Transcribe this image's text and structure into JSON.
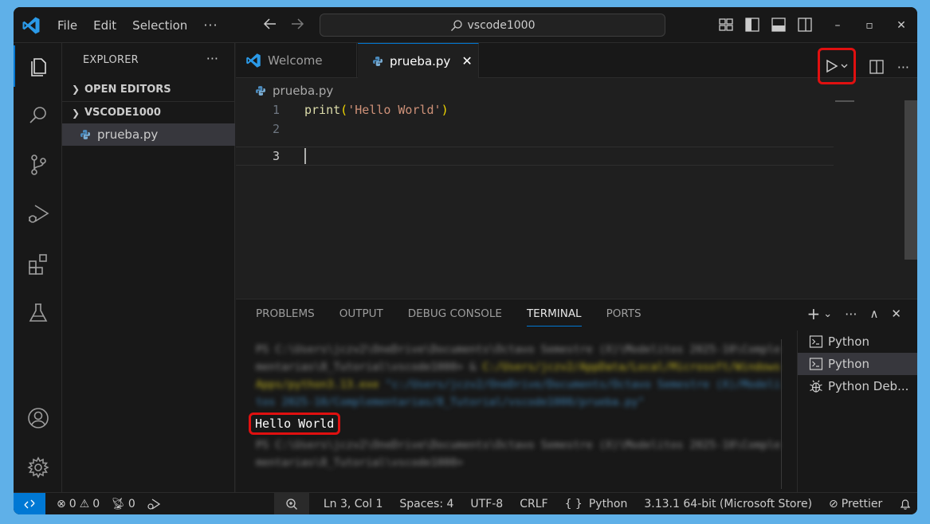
{
  "menu": {
    "file": "File",
    "edit": "Edit",
    "selection": "Selection",
    "more": "···"
  },
  "search": {
    "text": "vscode1000"
  },
  "window_controls": {
    "minimize": "–",
    "restore": "▫",
    "close": "✕"
  },
  "explorer": {
    "title": "EXPLORER",
    "more": "···",
    "open_editors": "OPEN EDITORS",
    "folder": "VSCODE1000",
    "file": "prueba.py"
  },
  "tabs": [
    {
      "label": "Welcome"
    },
    {
      "label": "prueba.py",
      "close": "✕"
    }
  ],
  "editor": {
    "breadcrumb": "prueba.py",
    "lines": [
      {
        "n": "1",
        "fn": "print",
        "open": "(",
        "str": "'Hello World'",
        "close": ")"
      },
      {
        "n": "2"
      },
      {
        "n": "3"
      }
    ]
  },
  "panel": {
    "tabs": [
      "PROBLEMS",
      "OUTPUT",
      "DEBUG CONSOLE",
      "TERMINAL",
      "PORTS"
    ],
    "active_tab": "TERMINAL",
    "actions": {
      "add": "+",
      "dropdown": "⌄",
      "more": "···",
      "maximize": "∧",
      "close": "✕"
    },
    "terminal": {
      "cmd1": "PS C:\\Users\\jczv2\\OneDrive\\Documents\\Octavo Semestre (X)\\Modelitos 2025-10\\Complementarias\\8_Tutorial\\vscode1000> & ",
      "cmd1_exe": "C:/Users/jczv2/AppData/Local/Microsoft/WindowsApps/python3.13.exe",
      "cmd1_arg": " \"c:/Users/jczv2/OneDrive/Documents/Octavo Semestre (X)/Modelitos 2025-10/Complementarias/8_Tutorial/vscode1000/prueba.py\"",
      "output": "Hello World",
      "cmd2": "PS C:\\Users\\jczv2\\OneDrive\\Documents\\Octavo Semestre (X)\\Modelitos 2025-10\\Complementarias\\8_Tutorial\\vscode1000> "
    },
    "terminals": [
      {
        "label": "Python",
        "icon": "terminal-icon"
      },
      {
        "label": "Python",
        "icon": "terminal-icon"
      },
      {
        "label": "Python Deb...",
        "icon": "debug-icon"
      }
    ]
  },
  "status": {
    "errors": "0",
    "warnings": "0",
    "ports": "0",
    "position": "Ln 3, Col 1",
    "spaces": "Spaces: 4",
    "encoding": "UTF-8",
    "eol": "CRLF",
    "language": "Python",
    "language_icon": "{ }",
    "interpreter": "3.13.1 64-bit (Microsoft Store)",
    "prettier": "Prettier"
  },
  "colors": {
    "accent": "#0078d4",
    "highlight": "#e01010"
  }
}
